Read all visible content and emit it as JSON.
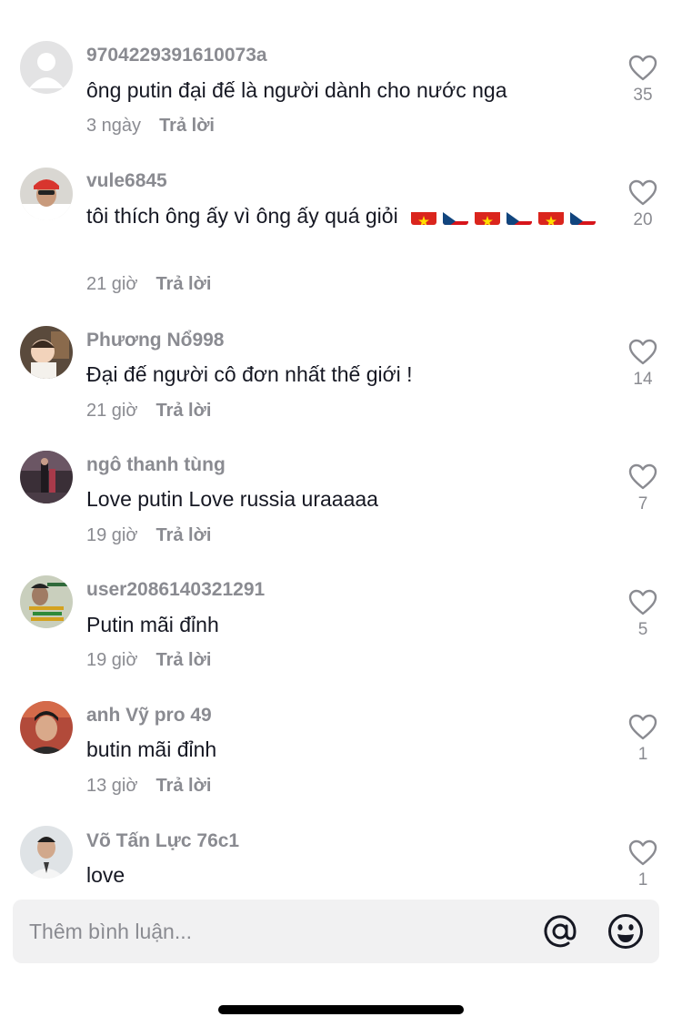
{
  "comments": [
    {
      "username": "9704229391610073a",
      "text": "ông putin đại đế là người dành cho nước nga",
      "flags": [],
      "time": "3 ngày",
      "reply": "Trả lời",
      "likes": "35",
      "avatar": "default-avatar"
    },
    {
      "username": "vule6845",
      "text": "tôi thích ông ấy vì ông ấy quá giỏi",
      "flags": [
        "vn",
        "cz",
        "vn",
        "cz",
        "vn",
        "cz"
      ],
      "time": "21 giờ",
      "reply": "Trả lời",
      "likes": "20",
      "avatar": "user-photo"
    },
    {
      "username": "Phương Nổ998",
      "text": "Đại đế người cô đơn nhất thế giới !",
      "flags": [],
      "time": "21 giờ",
      "reply": "Trả lời",
      "likes": "14",
      "avatar": "user-photo"
    },
    {
      "username": "ngô thanh tùng",
      "text": "Love putin Love russia uraaaaa",
      "flags": [],
      "time": "19 giờ",
      "reply": "Trả lời",
      "likes": "7",
      "avatar": "user-photo"
    },
    {
      "username": "user2086140321291",
      "text": "Putin mãi đỉnh",
      "flags": [],
      "time": "19 giờ",
      "reply": "Trả lời",
      "likes": "5",
      "avatar": "user-photo"
    },
    {
      "username": "anh Vỹ pro 49",
      "text": "butin mãi đỉnh",
      "flags": [],
      "time": "13 giờ",
      "reply": "Trả lời",
      "likes": "1",
      "avatar": "user-photo"
    },
    {
      "username": "Võ Tấn Lực 76c1",
      "text": "love",
      "flags": [],
      "time": "",
      "reply": "",
      "likes": "1",
      "avatar": "user-photo"
    }
  ],
  "input": {
    "placeholder": "Thêm bình luận..."
  },
  "icons": {
    "like": "heart-outline-icon",
    "mention": "at-sign-icon",
    "emoji": "smiley-icon"
  },
  "colors": {
    "muted": "#8a8b91",
    "text": "#161823",
    "input_bg": "#f1f1f2"
  }
}
